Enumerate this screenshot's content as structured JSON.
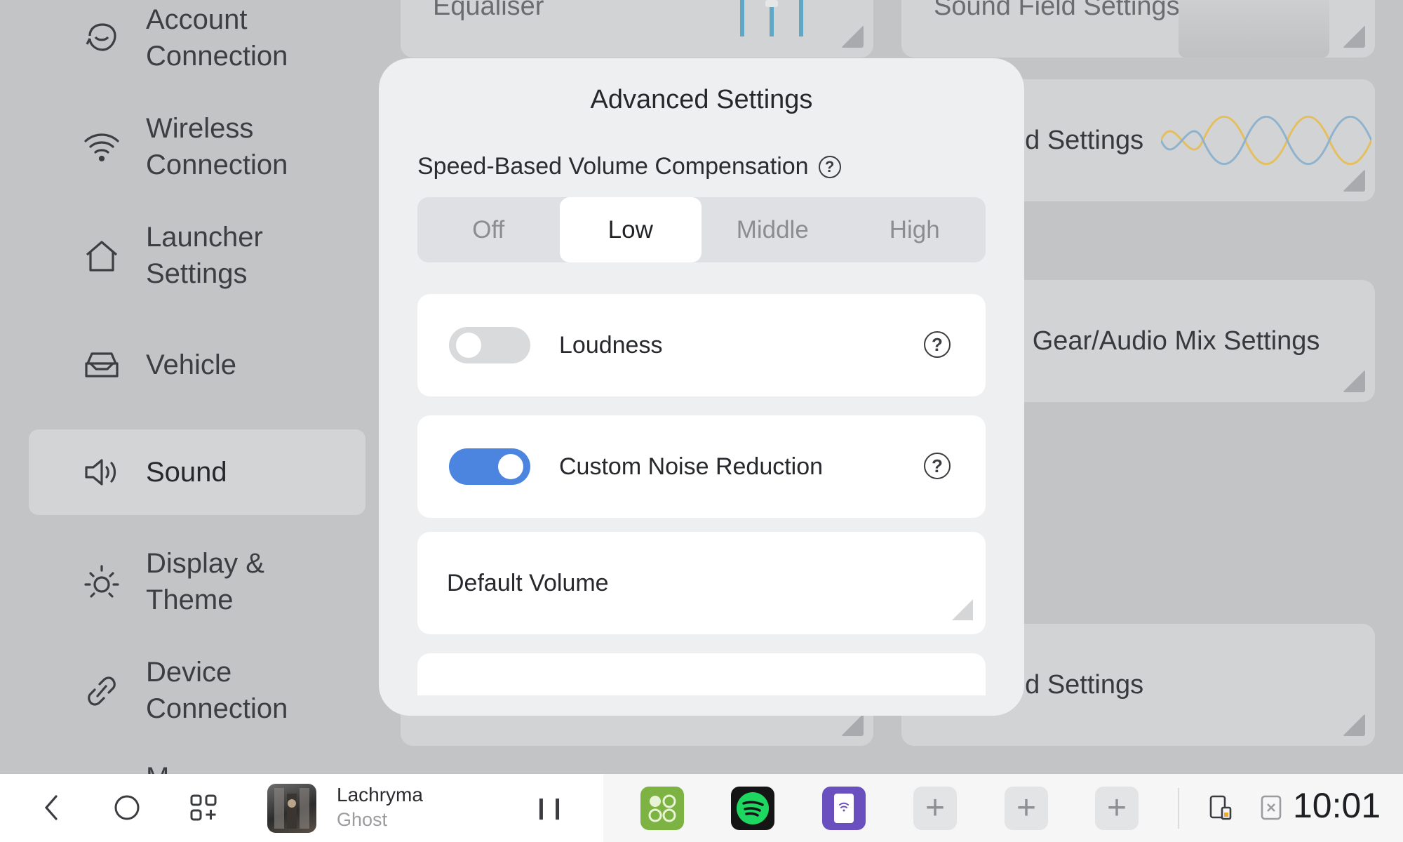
{
  "sidebar": {
    "items": [
      {
        "label_line1": "Account",
        "label_line2": "Connection",
        "icon": "account-icon"
      },
      {
        "label_line1": "Wireless",
        "label_line2": "Connection",
        "icon": "wifi-icon"
      },
      {
        "label_line1": "Launcher",
        "label_line2": "Settings",
        "icon": "home-icon"
      },
      {
        "label_line1": "Vehicle",
        "label_line2": "",
        "icon": "car-icon"
      },
      {
        "label_line1": "Sound",
        "label_line2": "",
        "icon": "speaker-icon",
        "active": true
      },
      {
        "label_line1": "Display &",
        "label_line2": "Theme",
        "icon": "sun-icon"
      },
      {
        "label_line1": "Device",
        "label_line2": "Connection",
        "icon": "link-icon"
      },
      {
        "label_line1": "M",
        "label_line2": "",
        "icon": ""
      }
    ]
  },
  "background_cards": {
    "equaliser": "Equaliser",
    "sound_field": "Sound Field Settings",
    "advanced_top": "ed Settings",
    "gear_mix": "e Gear/Audio Mix Settings",
    "advanced_bottom": "ed Settings"
  },
  "modal": {
    "title": "Advanced Settings",
    "speed_comp_label": "Speed-Based Volume Compensation",
    "segments": [
      "Off",
      "Low",
      "Middle",
      "High"
    ],
    "selected_segment": "Low",
    "loudness": {
      "label": "Loudness",
      "on": false
    },
    "noise_reduction": {
      "label": "Custom Noise Reduction",
      "on": true
    },
    "default_volume": {
      "label": "Default Volume"
    },
    "help_glyph": "?"
  },
  "taskbar": {
    "media": {
      "song": "Lachryma",
      "artist": "Ghost"
    },
    "pause_glyph": "❙❙",
    "plus_glyph": "+",
    "time": "10:01"
  },
  "colors": {
    "accent": "#4c85e0",
    "spotify": "#1ed760",
    "green_app": "#7cb342",
    "purple_app": "#6a4fbf"
  }
}
